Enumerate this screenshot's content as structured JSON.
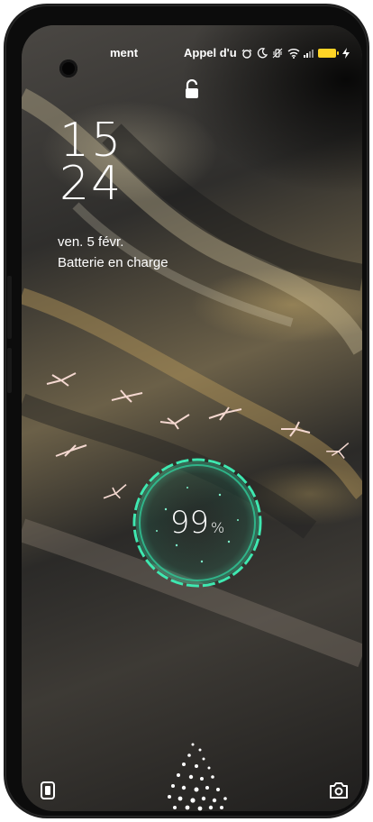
{
  "status_bar": {
    "left_text": "ment",
    "right_text": "Appel d'u",
    "icons": [
      "alarm-icon",
      "do-not-disturb-icon",
      "vibrate-icon",
      "wifi-icon",
      "signal-icon",
      "battery-icon",
      "charging-icon"
    ],
    "battery_color": "#ffd426"
  },
  "lock": {
    "icon": "lock-icon"
  },
  "clock": {
    "hours": "15",
    "minutes": "24"
  },
  "date": "ven. 5 févr.",
  "charge_status": "Batterie en charge",
  "charging": {
    "percent": "99",
    "unit": "%",
    "ring_color": "#3ee8b0"
  },
  "shortcuts": {
    "left": "wallet-icon",
    "right": "camera-icon"
  }
}
